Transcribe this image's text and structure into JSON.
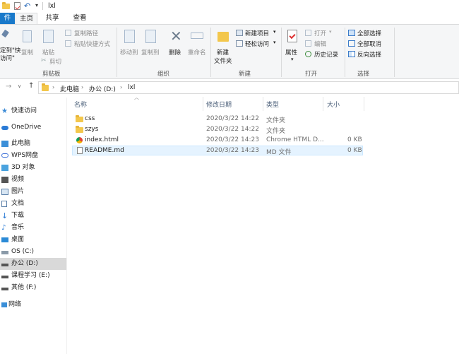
{
  "window": {
    "title": "lxl"
  },
  "tabs": [
    {
      "label": "件"
    },
    {
      "label": "主页"
    },
    {
      "label": "共享"
    },
    {
      "label": "查看"
    }
  ],
  "ribbon": {
    "pin_label_1": "定到\"快",
    "pin_label_2": "访问\"",
    "copy": "复制",
    "paste": "粘贴",
    "copy_path": "复制路径",
    "paste_shortcut": "粘贴快捷方式",
    "cut": "剪切",
    "clipboard_group": "剪贴板",
    "move_to": "移动到",
    "copy_to": "复制到",
    "delete": "删除",
    "rename": "重命名",
    "organize_group": "组织",
    "new_item": "新建项目",
    "easy_access": "轻松访问",
    "new_folder_1": "新建",
    "new_folder_2": "文件夹",
    "new_group": "新建",
    "open": "打开",
    "edit": "编辑",
    "history": "历史记录",
    "properties": "属性",
    "open_group": "打开",
    "select_all": "全部选择",
    "select_none": "全部取消",
    "invert_selection": "反向选择",
    "select_group": "选择"
  },
  "address": {
    "crumbs": [
      "此电脑",
      "办公 (D:)",
      "lxl"
    ]
  },
  "nav": [
    {
      "label": "快速访问",
      "icon": "star-icon"
    },
    {
      "label": "OneDrive",
      "icon": "cloud-icon"
    },
    {
      "label": "此电脑",
      "icon": "computer-icon"
    },
    {
      "label": "WPS网盘",
      "icon": "wps-cloud-icon"
    },
    {
      "label": "3D 对象",
      "icon": "cube-icon"
    },
    {
      "label": "视频",
      "icon": "video-icon"
    },
    {
      "label": "图片",
      "icon": "picture-icon"
    },
    {
      "label": "文档",
      "icon": "document-icon"
    },
    {
      "label": "下载",
      "icon": "download-icon"
    },
    {
      "label": "音乐",
      "icon": "music-icon"
    },
    {
      "label": "桌面",
      "icon": "desktop-icon"
    },
    {
      "label": "OS (C:)",
      "icon": "drive-icon"
    },
    {
      "label": "办公 (D:)",
      "icon": "drive-icon"
    },
    {
      "label": "课程学习 (E:)",
      "icon": "drive-icon"
    },
    {
      "label": "其他 (F:)",
      "icon": "drive-icon"
    },
    {
      "label": "网络",
      "icon": "network-icon"
    }
  ],
  "columns": {
    "name": "名称",
    "date": "修改日期",
    "type": "类型",
    "size": "大小"
  },
  "files": [
    {
      "name": "css",
      "date": "2020/3/22 14:22",
      "type": "文件夹",
      "size": "",
      "icon": "folder-icon"
    },
    {
      "name": "szys",
      "date": "2020/3/22 14:22",
      "type": "文件夹",
      "size": "",
      "icon": "folder-icon"
    },
    {
      "name": "index.html",
      "date": "2020/3/22 14:23",
      "type": "Chrome HTML D...",
      "size": "0 KB",
      "icon": "chrome-icon"
    },
    {
      "name": "README.md",
      "date": "2020/3/22 14:23",
      "type": "MD 文件",
      "size": "0 KB",
      "icon": "file-icon"
    }
  ]
}
